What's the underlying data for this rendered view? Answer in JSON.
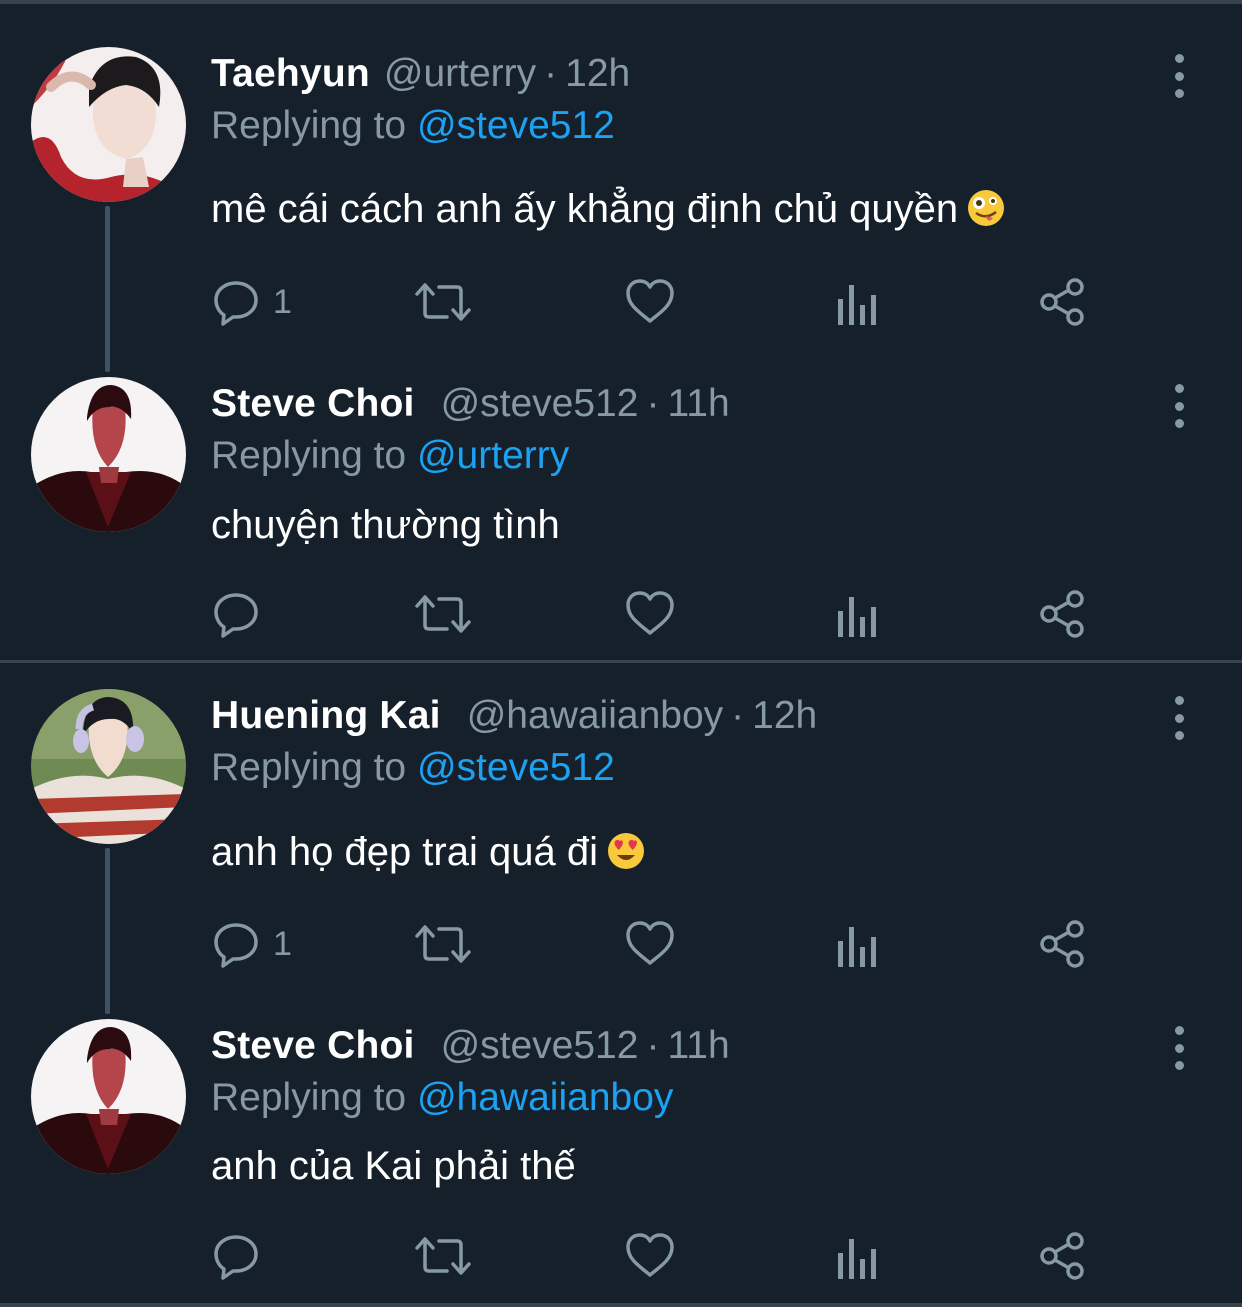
{
  "colors": {
    "background": "#15202b",
    "divider": "#38444d",
    "primary_text": "#ffffff",
    "secondary_text": "#8899a6",
    "mention": "#1da1f2"
  },
  "replying_prefix": "Replying to",
  "time_separator": "·",
  "icons": [
    "reply-icon",
    "retweet-icon",
    "like-icon",
    "analytics-icon",
    "share-icon",
    "more-icon"
  ],
  "tweets": [
    {
      "name": "Taehyun",
      "handle": "@urterry",
      "time": "12h",
      "replying_to": "@steve512",
      "text": "mê cái cách anh ấy khẳng định chủ quyền",
      "emoji": "zany-face",
      "reply_count": "1"
    },
    {
      "name": "Steve Choi",
      "handle": "@steve512",
      "time": "11h",
      "replying_to": "@urterry",
      "text": "chuyện thường tình",
      "reply_count": ""
    },
    {
      "name": "Huening Kai",
      "handle": "@hawaiianboy",
      "time": "12h",
      "replying_to": "@steve512",
      "text": "anh họ đẹp trai quá đi",
      "emoji": "heart-eyes-face",
      "reply_count": "1"
    },
    {
      "name": "Steve Choi",
      "handle": "@steve512",
      "time": "11h",
      "replying_to": "@hawaiianboy",
      "text": "anh của Kai phải thế",
      "reply_count": ""
    }
  ]
}
